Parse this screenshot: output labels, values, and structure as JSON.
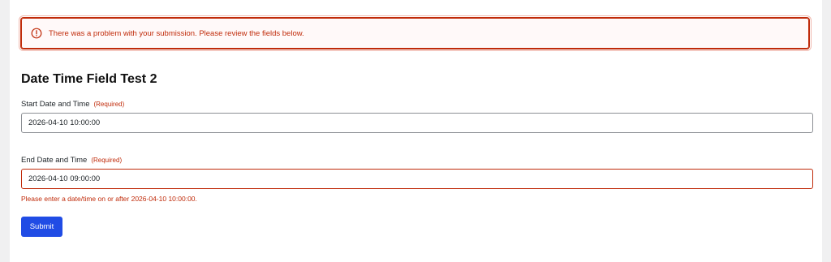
{
  "alert": {
    "icon": "exclamation-circle-icon",
    "message": "There was a problem with your submission. Please review the fields below.",
    "color": "#c02b0a"
  },
  "form": {
    "title": "Date Time Field Test 2",
    "fields": [
      {
        "label": "Start Date and Time",
        "required_text": "(Required)",
        "value": "2026-04-10 10:00:00"
      },
      {
        "label": "End Date and Time",
        "required_text": "(Required)",
        "value": "2026-04-10 09:00:00",
        "error": "Please enter a date/time on or after 2026-04-10 10:00:00."
      }
    ],
    "submit_label": "Submit",
    "accent_color": "#204ce5"
  }
}
